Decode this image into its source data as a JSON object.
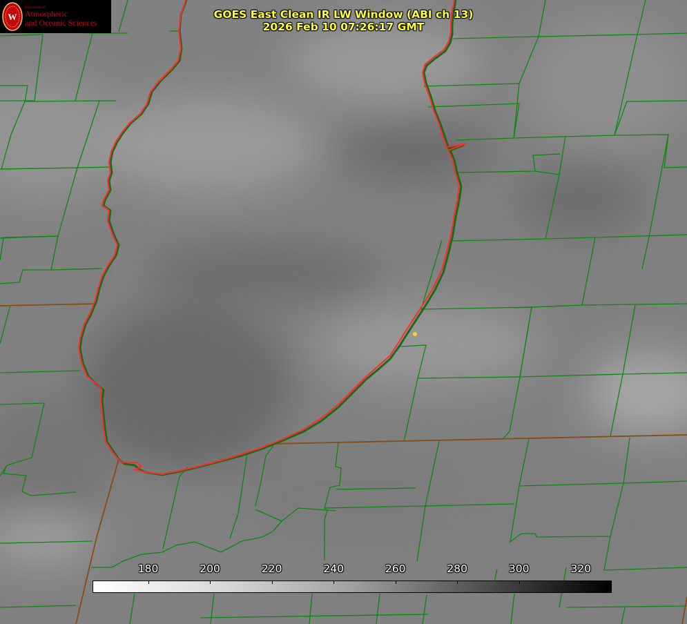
{
  "title": {
    "line1": "GOES East Clean IR LW Window (ABI ch 13)",
    "line2": "2026 Feb 10 07:26:17 GMT"
  },
  "logo": {
    "small": "Department of",
    "line1": "Atmospheric",
    "line2": "and Oceanic Sciences",
    "seal_letter": "W"
  },
  "colorbar": {
    "ticks": [
      "180",
      "200",
      "220",
      "240",
      "260",
      "280",
      "300",
      "320"
    ],
    "range": [
      162,
      330
    ]
  },
  "colors": {
    "lake_outline": "#ff2a2a",
    "county_lines": "#0a8a0a",
    "state_lines": "#8a4a10",
    "title_text": "#ffff33",
    "marker": "#ffd21a"
  }
}
